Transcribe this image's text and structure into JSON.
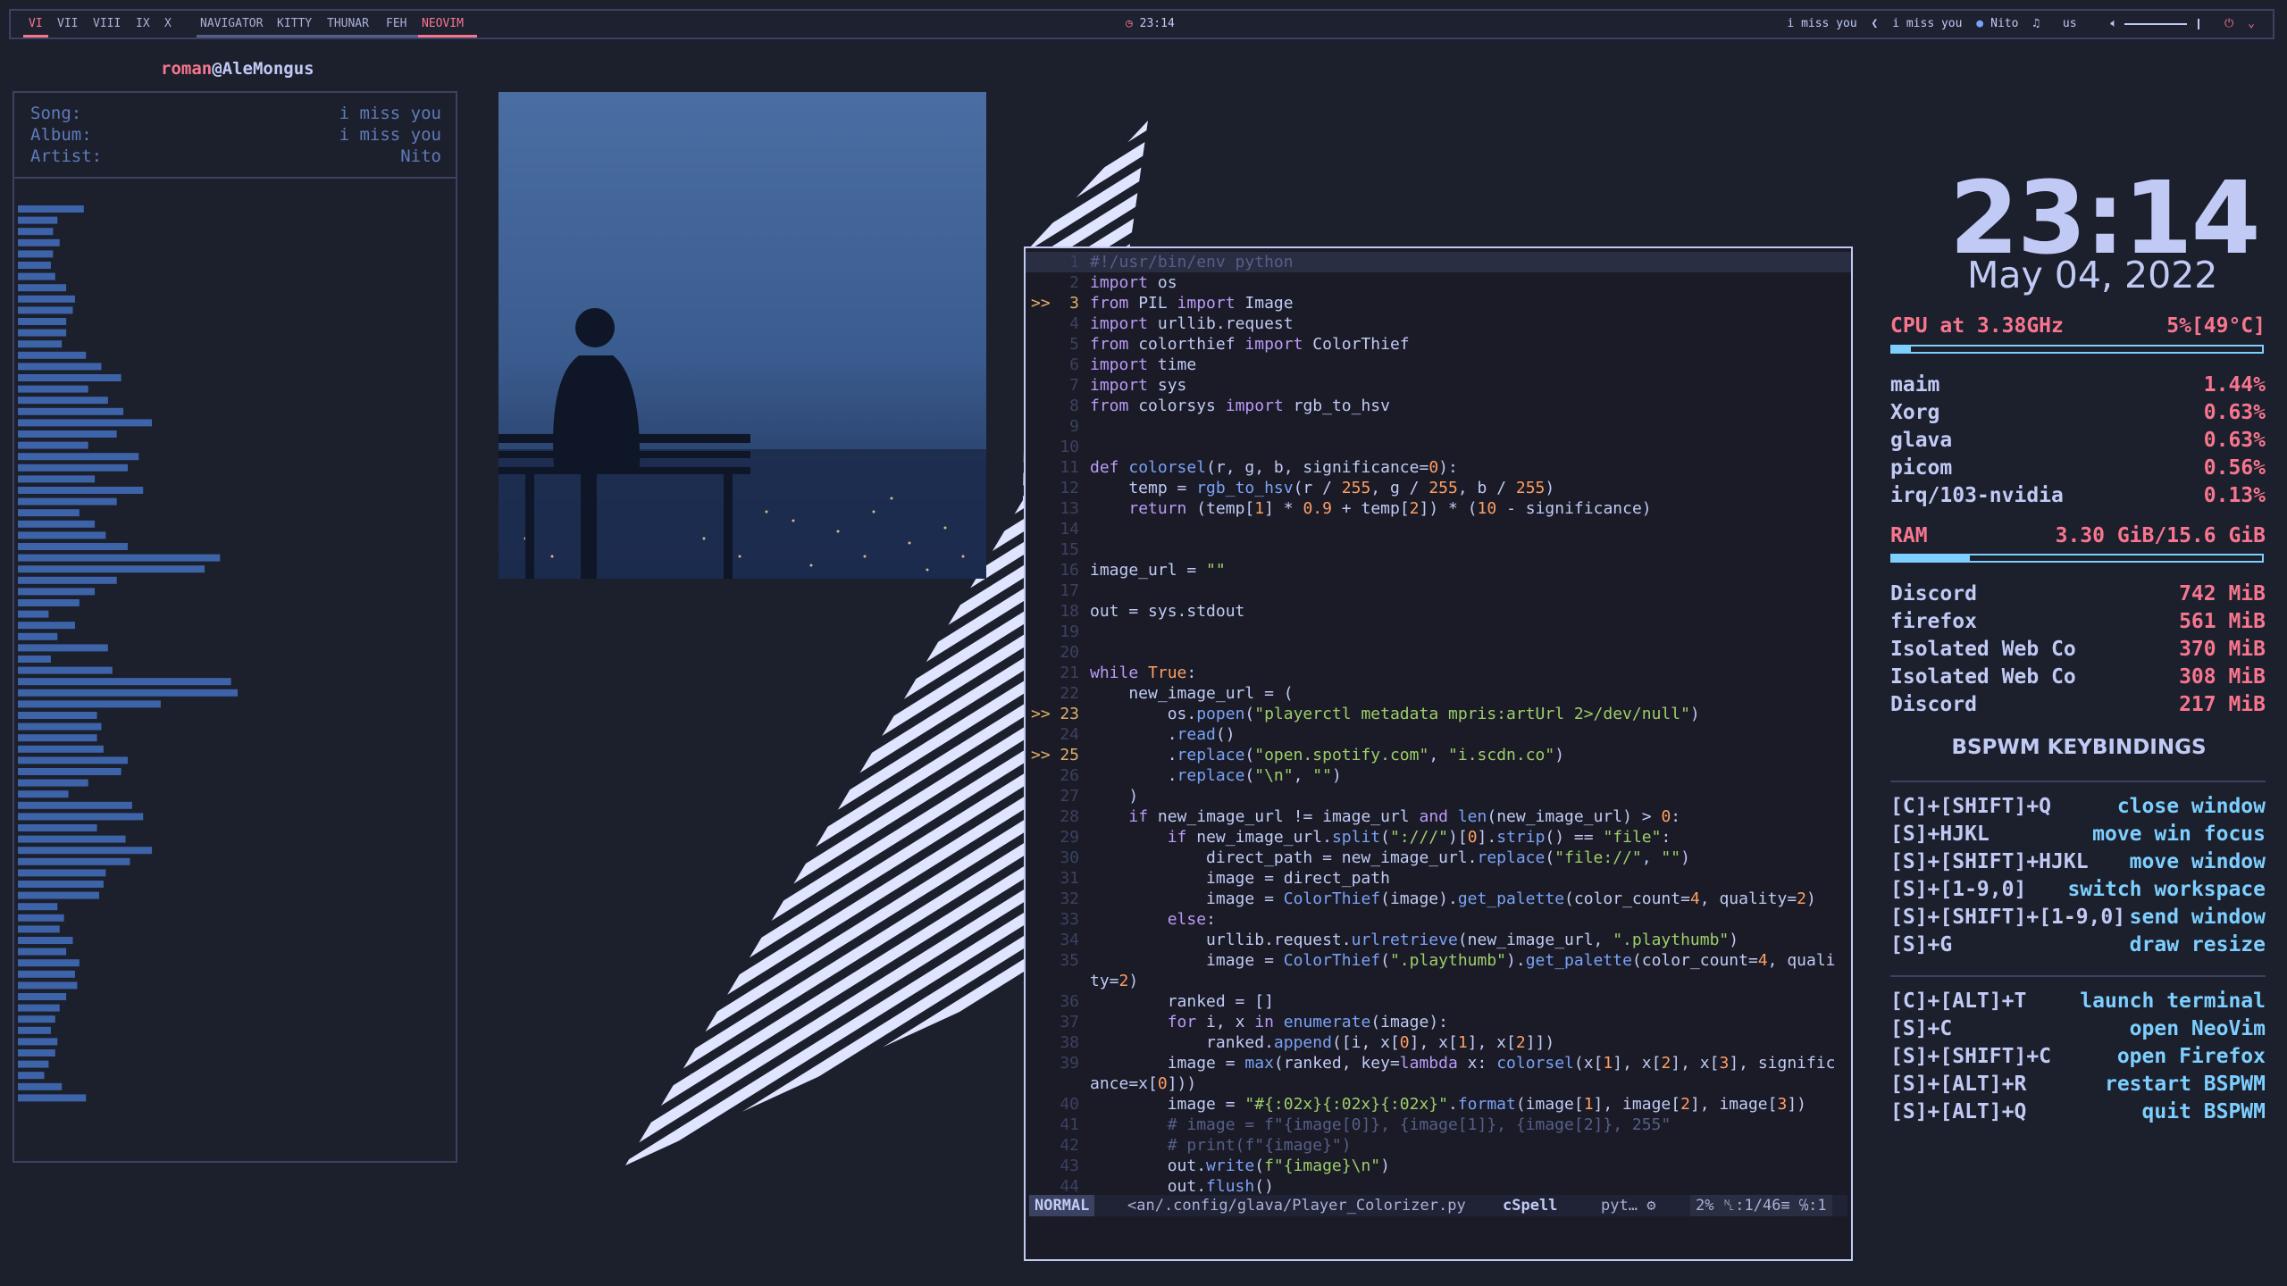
{
  "topbar": {
    "workspaces": [
      "VI",
      "VII",
      "VIII",
      "IX",
      "X"
    ],
    "active_workspace": "VI",
    "apps": [
      "NAVIGATOR",
      "KITTY",
      "THUNAR",
      "FEH",
      "NEOVIM"
    ],
    "active_app": "NEOVIM",
    "clock": "23:14",
    "now_playing_1": "i miss you",
    "now_playing_2": "i miss you",
    "artist": "Nito",
    "layout": "us"
  },
  "user": {
    "name": "roman",
    "host": "@AleMongus"
  },
  "player": {
    "song_label": "Song:",
    "song": "i miss you",
    "album_label": "Album:",
    "album": "i miss you",
    "artist_label": "Artist:",
    "artist": "Nito"
  },
  "visualizer_levels": [
    0.3,
    0.18,
    0.16,
    0.19,
    0.16,
    0.15,
    0.17,
    0.22,
    0.26,
    0.25,
    0.22,
    0.22,
    0.2,
    0.31,
    0.38,
    0.47,
    0.32,
    0.41,
    0.48,
    0.61,
    0.45,
    0.32,
    0.55,
    0.5,
    0.35,
    0.57,
    0.45,
    0.28,
    0.35,
    0.4,
    0.5,
    0.92,
    0.85,
    0.45,
    0.35,
    0.28,
    0.14,
    0.26,
    0.18,
    0.41,
    0.15,
    0.43,
    0.97,
    1.0,
    0.65,
    0.36,
    0.38,
    0.36,
    0.39,
    0.5,
    0.47,
    0.32,
    0.23,
    0.52,
    0.57,
    0.36,
    0.49,
    0.61,
    0.51,
    0.4,
    0.39,
    0.37,
    0.18,
    0.21,
    0.19,
    0.25,
    0.22,
    0.28,
    0.26,
    0.27,
    0.22,
    0.19,
    0.17,
    0.15,
    0.18,
    0.17,
    0.14,
    0.12,
    0.2,
    0.31
  ],
  "editor": {
    "lines": [
      {
        "n": "1",
        "sign": "",
        "html": "<span class=\"c\">#!/usr/bin/env python</span>"
      },
      {
        "n": "2",
        "sign": "",
        "html": "<span class=\"k\">import</span> os"
      },
      {
        "n": "3",
        "sign": ">>",
        "html": "<span class=\"k\">from</span> PIL <span class=\"k\">import</span> Image"
      },
      {
        "n": "4",
        "sign": "",
        "html": "<span class=\"k\">import</span> urllib.request"
      },
      {
        "n": "5",
        "sign": "",
        "html": "<span class=\"k\">from</span> colorthief <span class=\"k\">import</span> ColorThief"
      },
      {
        "n": "6",
        "sign": "",
        "html": "<span class=\"k\">import</span> time"
      },
      {
        "n": "7",
        "sign": "",
        "html": "<span class=\"k\">import</span> sys"
      },
      {
        "n": "8",
        "sign": "",
        "html": "<span class=\"k\">from</span> colorsys <span class=\"k\">import</span> rgb_to_hsv"
      },
      {
        "n": "9",
        "sign": "",
        "html": ""
      },
      {
        "n": "10",
        "sign": "",
        "html": ""
      },
      {
        "n": "11",
        "sign": "",
        "html": "<span class=\"k\">def</span> <span class=\"f\">colorsel</span>(r, g, b, significance=<span class=\"n\">0</span>):"
      },
      {
        "n": "12",
        "sign": "",
        "html": "    temp = <span class=\"f\">rgb_to_hsv</span>(r / <span class=\"n\">255</span>, g / <span class=\"n\">255</span>, b / <span class=\"n\">255</span>)"
      },
      {
        "n": "13",
        "sign": "",
        "html": "    <span class=\"k\">return</span> (temp[<span class=\"n\">1</span>] * <span class=\"n\">0.9</span> + temp[<span class=\"n\">2</span>]) * (<span class=\"n\">10</span> - significance)"
      },
      {
        "n": "14",
        "sign": "",
        "html": ""
      },
      {
        "n": "15",
        "sign": "",
        "html": ""
      },
      {
        "n": "16",
        "sign": "",
        "html": "image_url = <span class=\"s\">\"\"</span>"
      },
      {
        "n": "17",
        "sign": "",
        "html": ""
      },
      {
        "n": "18",
        "sign": "",
        "html": "out = sys.stdout"
      },
      {
        "n": "19",
        "sign": "",
        "html": ""
      },
      {
        "n": "20",
        "sign": "",
        "html": ""
      },
      {
        "n": "21",
        "sign": "",
        "html": "<span class=\"k\">while</span> <span class=\"n\">True</span>:"
      },
      {
        "n": "22",
        "sign": "",
        "html": "    new_image_url = ("
      },
      {
        "n": "23",
        "sign": ">>",
        "html": "        os.<span class=\"f\">popen</span>(<span class=\"s\">\"playerctl metadata mpris:artUrl 2>/dev/null\"</span>)"
      },
      {
        "n": "24",
        "sign": "",
        "html": "        .<span class=\"f\">read</span>()"
      },
      {
        "n": "25",
        "sign": ">>",
        "html": "        .<span class=\"f\">replace</span>(<span class=\"s\">\"open.spotify.com\"</span>, <span class=\"s\">\"i.scdn.co\"</span>)"
      },
      {
        "n": "26",
        "sign": "",
        "html": "        .<span class=\"f\">replace</span>(<span class=\"s\">\"\\n\"</span>, <span class=\"s\">\"\"</span>)"
      },
      {
        "n": "27",
        "sign": "",
        "html": "    )"
      },
      {
        "n": "28",
        "sign": "",
        "html": "    <span class=\"k\">if</span> new_image_url != image_url <span class=\"k\">and</span> <span class=\"f\">len</span>(new_image_url) > <span class=\"n\">0</span>:"
      },
      {
        "n": "29",
        "sign": "",
        "html": "        <span class=\"k\">if</span> new_image_url.<span class=\"f\">split</span>(<span class=\"s\">\":///\"</span>)[<span class=\"n\">0</span>].<span class=\"f\">strip</span>() == <span class=\"s\">\"file\"</span>:"
      },
      {
        "n": "30",
        "sign": "",
        "html": "            direct_path = new_image_url.<span class=\"f\">replace</span>(<span class=\"s\">\"file://\"</span>, <span class=\"s\">\"\"</span>)"
      },
      {
        "n": "31",
        "sign": "",
        "html": "            image = direct_path"
      },
      {
        "n": "32",
        "sign": "",
        "html": "            image = <span class=\"f\">ColorThief</span>(image).<span class=\"f\">get_palette</span>(color_count=<span class=\"n\">4</span>, quality=<span class=\"n\">2</span>)"
      },
      {
        "n": "33",
        "sign": "",
        "html": "        <span class=\"k\">else</span>:"
      },
      {
        "n": "34",
        "sign": "",
        "html": "            urllib.request.<span class=\"f\">urlretrieve</span>(new_image_url, <span class=\"s\">\".playthumb\"</span>)"
      },
      {
        "n": "35",
        "sign": "",
        "html": "            image = <span class=\"f\">ColorThief</span>(<span class=\"s\">\".playthumb\"</span>).<span class=\"f\">get_palette</span>(color_count=<span class=\"n\">4</span>, quali"
      },
      {
        "n": "",
        "sign": "",
        "html": "ty=<span class=\"n\">2</span>)"
      },
      {
        "n": "36",
        "sign": "",
        "html": "        ranked = []"
      },
      {
        "n": "37",
        "sign": "",
        "html": "        <span class=\"k\">for</span> i, x <span class=\"k\">in</span> <span class=\"f\">enumerate</span>(image):"
      },
      {
        "n": "38",
        "sign": "",
        "html": "            ranked.<span class=\"f\">append</span>([i, x[<span class=\"n\">0</span>], x[<span class=\"n\">1</span>], x[<span class=\"n\">2</span>]])"
      },
      {
        "n": "39",
        "sign": "",
        "html": "        image = <span class=\"f\">max</span>(ranked, key=<span class=\"k\">lambda</span> x: <span class=\"f\">colorsel</span>(x[<span class=\"n\">1</span>], x[<span class=\"n\">2</span>], x[<span class=\"n\">3</span>], signific"
      },
      {
        "n": "",
        "sign": "",
        "html": "ance=x[<span class=\"n\">0</span>]))"
      },
      {
        "n": "40",
        "sign": "",
        "html": "        image = <span class=\"s\">\"#{:02x}{:02x}{:02x}\"</span>.<span class=\"f\">format</span>(image[<span class=\"n\">1</span>], image[<span class=\"n\">2</span>], image[<span class=\"n\">3</span>])"
      },
      {
        "n": "41",
        "sign": "",
        "html": "        <span class=\"c\"># image = f\"{image[0]}, {image[1]}, {image[2]}, 255\"</span>"
      },
      {
        "n": "42",
        "sign": "",
        "html": "        <span class=\"c\"># print(f\"{image}\")</span>"
      },
      {
        "n": "43",
        "sign": "",
        "html": "        out.<span class=\"f\">write</span>(<span class=\"s\">f\"{image}\\n\"</span>)"
      },
      {
        "n": "44",
        "sign": "",
        "html": "        out.<span class=\"f\">flush</span>()"
      }
    ],
    "status": {
      "mode": "NORMAL",
      "file": "<an/.config/glava/Player_Colorizer.py",
      "spell": "cSpell",
      "filetype": "pyt…",
      "position": "2% ␤:1/46≡ ℅:1"
    }
  },
  "sysinfo": {
    "clock": "23:14",
    "date": "May 04, 2022",
    "cpu_label": "CPU at 3.38GHz",
    "cpu_value": "5%[49°C]",
    "cpu_fraction": 0.05,
    "processes_cpu": [
      {
        "name": "maim",
        "value": "1.44%"
      },
      {
        "name": "Xorg",
        "value": "0.63%"
      },
      {
        "name": "glava",
        "value": "0.63%"
      },
      {
        "name": "picom",
        "value": "0.56%"
      },
      {
        "name": "irq/103-nvidia",
        "value": "0.13%"
      }
    ],
    "ram_label": "RAM",
    "ram_value": "3.30 GiB/15.6 GiB",
    "ram_fraction": 0.21,
    "processes_mem": [
      {
        "name": "Discord",
        "value": "742 MiB"
      },
      {
        "name": "firefox",
        "value": "561 MiB"
      },
      {
        "name": "Isolated Web Co",
        "value": "370 MiB"
      },
      {
        "name": "Isolated Web Co",
        "value": "308 MiB"
      },
      {
        "name": "Discord",
        "value": "217 MiB"
      }
    ],
    "keybindings_title": "BSPWM KEYBINDINGS",
    "keybindings_1": [
      {
        "key": "[C]+[SHIFT]+Q",
        "action": "close window"
      },
      {
        "key": "[S]+HJKL",
        "action": "move win focus"
      },
      {
        "key": "[S]+[SHIFT]+HJKL",
        "action": "move window"
      },
      {
        "key": "[S]+[1-9,0]",
        "action": "switch workspace"
      },
      {
        "key": "[S]+[SHIFT]+[1-9,0]",
        "action": "send window"
      },
      {
        "key": "[S]+G",
        "action": "draw resize"
      }
    ],
    "keybindings_2": [
      {
        "key": "[C]+[ALT]+T",
        "action": "launch terminal"
      },
      {
        "key": "[S]+C",
        "action": "open NeoVim"
      },
      {
        "key": "[S]+[SHIFT]+C",
        "action": "open Firefox"
      },
      {
        "key": "[S]+[ALT]+R",
        "action": "restart BSPWM"
      },
      {
        "key": "[S]+[ALT]+Q",
        "action": "quit BSPWM"
      }
    ]
  }
}
